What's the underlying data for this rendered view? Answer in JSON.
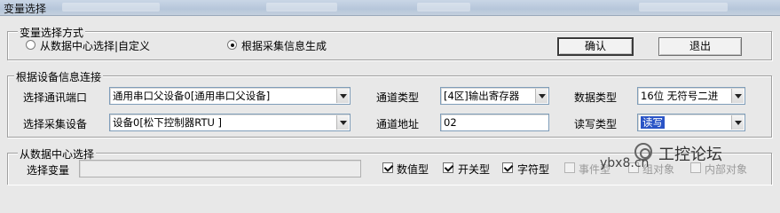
{
  "window": {
    "title": "变量选择"
  },
  "select_mode": {
    "legend": "变量选择方式",
    "options": [
      {
        "label": "从数据中心选择|自定义",
        "selected": false
      },
      {
        "label": "根据采集信息生成",
        "selected": true
      }
    ],
    "ok_label": "确认",
    "exit_label": "退出"
  },
  "device_info": {
    "legend": "根据设备信息连接",
    "port_label": "选择通讯端口",
    "port_value": "通用串口父设备0[通用串口父设备]",
    "device_label": "选择采集设备",
    "device_value": "设备0[松下控制器RTU ]",
    "channel_type_label": "通道类型",
    "channel_type_value": "[4区]输出寄存器",
    "channel_addr_label": "通道地址",
    "channel_addr_value": "02",
    "data_type_label": "数据类型",
    "data_type_value": "16位 无符号二进",
    "rw_type_label": "读写类型",
    "rw_type_value": "读写"
  },
  "data_center": {
    "legend": "从数据中心选择",
    "var_label": "选择变量",
    "var_value": "",
    "filters": [
      {
        "label": "数值型",
        "checked": true,
        "enabled": true
      },
      {
        "label": "开关型",
        "checked": true,
        "enabled": true
      },
      {
        "label": "字符型",
        "checked": true,
        "enabled": true
      },
      {
        "label": "事件型",
        "checked": false,
        "enabled": false
      },
      {
        "label": "组对象",
        "checked": false,
        "enabled": false
      },
      {
        "label": "内部对象",
        "checked": false,
        "enabled": false
      }
    ]
  },
  "watermark": {
    "site": "ybx8.cn",
    "logo": "工控论坛"
  }
}
